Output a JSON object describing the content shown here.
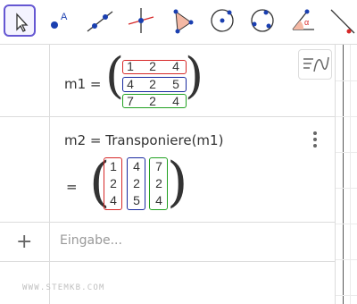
{
  "toolbar": {
    "tools": [
      {
        "name": "move-tool-icon",
        "active": true
      },
      {
        "name": "point-tool-icon",
        "active": false,
        "sublabel": "A"
      },
      {
        "name": "line-tool-icon",
        "active": false
      },
      {
        "name": "perpendicular-line-tool-icon",
        "active": false
      },
      {
        "name": "polygon-tool-icon",
        "active": false
      },
      {
        "name": "circle-center-point-tool-icon",
        "active": false
      },
      {
        "name": "circle-three-points-tool-icon",
        "active": false
      },
      {
        "name": "angle-tool-icon",
        "active": false,
        "sublabel": "α"
      },
      {
        "name": "reflect-tool-icon",
        "active": false
      }
    ],
    "accent": "#6557d2"
  },
  "algebra": {
    "row1": {
      "label": "m1 =",
      "matrix": [
        [
          "1",
          "2",
          "4"
        ],
        [
          "4",
          "2",
          "5"
        ],
        [
          "7",
          "2",
          "4"
        ]
      ],
      "row_colors": [
        "#d62828",
        "#1a2aa0",
        "#21a121"
      ]
    },
    "row2": {
      "definition": "m2 = Transponiere(m1)",
      "equals": "=",
      "matrix": [
        [
          "1",
          "4",
          "7"
        ],
        [
          "2",
          "2",
          "2"
        ],
        [
          "4",
          "5",
          "4"
        ]
      ],
      "col_colors": [
        "#d62828",
        "#1a2aa0",
        "#21a121"
      ]
    },
    "input": {
      "plus": "+",
      "placeholder": "Eingabe..."
    }
  },
  "watermark": "WWW.STEMKB.COM",
  "stylebar": {
    "icon": "algebra-style-bar-icon"
  }
}
